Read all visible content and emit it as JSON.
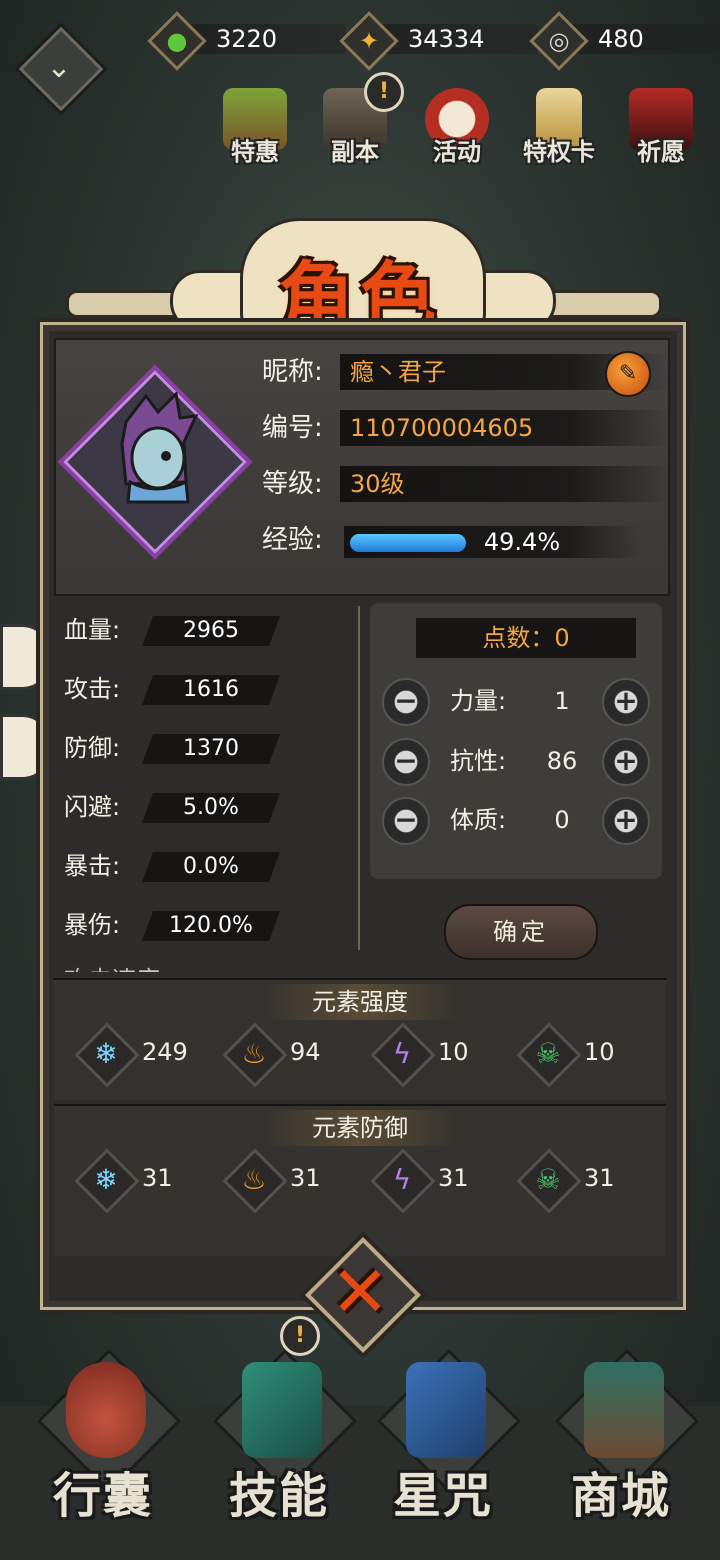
{
  "resources": [
    {
      "icon": "jade-icon",
      "value": "3220"
    },
    {
      "icon": "gold-coin-icon",
      "value": "34334"
    },
    {
      "icon": "silver-swirl-icon",
      "value": "480"
    }
  ],
  "features": [
    {
      "label": "特惠"
    },
    {
      "label": "副本",
      "alert": "!"
    },
    {
      "label": "活动"
    },
    {
      "label": "特权卡"
    },
    {
      "label": "祈愿"
    }
  ],
  "title": "角色",
  "profile": {
    "nickname_label": "昵称:",
    "nickname": "瘾丶君子",
    "id_label": "编号:",
    "id": "110700004605",
    "level_label": "等级:",
    "level": "30级",
    "exp_label": "经验:",
    "exp_text": "49.4%",
    "exp_fraction": 0.494
  },
  "stats": [
    {
      "label": "血量:",
      "value": "2965"
    },
    {
      "label": "攻击:",
      "value": "1616"
    },
    {
      "label": "防御:",
      "value": "1370"
    },
    {
      "label": "闪避:",
      "value": "5.0%"
    },
    {
      "label": "暴击:",
      "value": "0.0%"
    },
    {
      "label": "暴伤:",
      "value": "120.0%"
    }
  ],
  "stats_cutoff": "攻击速度",
  "points": {
    "header": "点数：0",
    "attributes": [
      {
        "label": "力量:",
        "value": "1"
      },
      {
        "label": "抗性:",
        "value": "86"
      },
      {
        "label": "体质:",
        "value": "0"
      }
    ],
    "confirm": "确定"
  },
  "element_strength": {
    "title": "元素强度",
    "items": [
      {
        "icon": "ice-icon",
        "value": "249"
      },
      {
        "icon": "fire-icon",
        "value": "94"
      },
      {
        "icon": "lightning-icon",
        "value": "10"
      },
      {
        "icon": "poison-skull-icon",
        "value": "10"
      }
    ]
  },
  "element_defense": {
    "title": "元素防御",
    "items": [
      {
        "icon": "ice-icon",
        "value": "31"
      },
      {
        "icon": "fire-icon",
        "value": "31"
      },
      {
        "icon": "lightning-icon",
        "value": "31"
      },
      {
        "icon": "poison-skull-icon",
        "value": "31"
      }
    ]
  },
  "nav": [
    {
      "label": "行囊"
    },
    {
      "label": "技能",
      "alert": "!"
    },
    {
      "label": "星咒"
    },
    {
      "label": "商城"
    }
  ],
  "colors": {
    "accent": "#e84a14",
    "value_orange": "#f4a642",
    "exp_blue": "#1e7ad8"
  }
}
